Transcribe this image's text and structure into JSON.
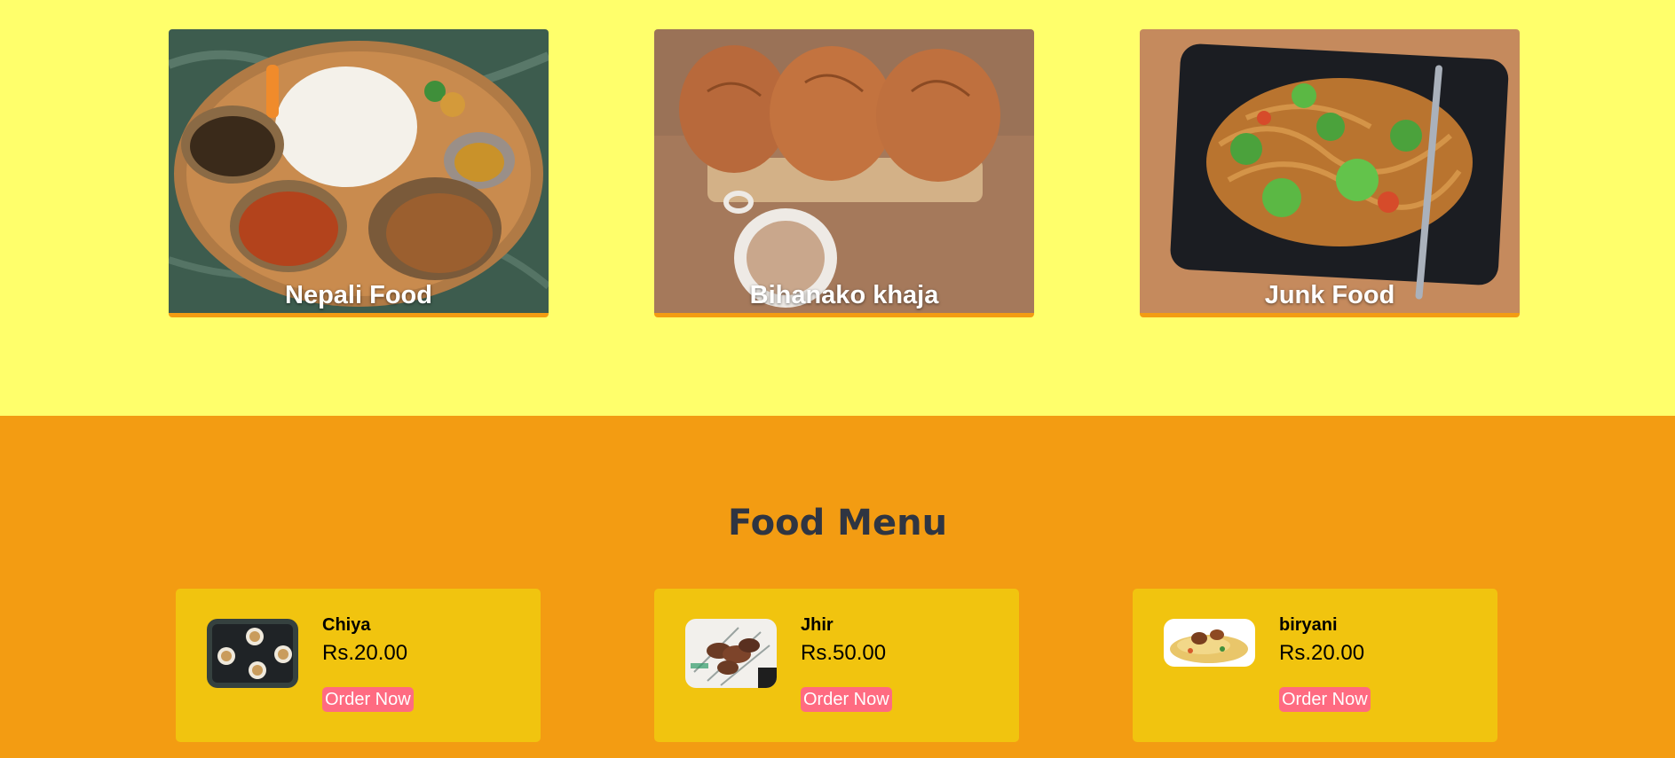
{
  "categories": [
    {
      "title": "Nepali Food",
      "image": "nepali-thali-photo"
    },
    {
      "title": "Bihanako khaja",
      "image": "bread-and-tea-photo"
    },
    {
      "title": "Junk Food",
      "image": "chowmein-photo"
    }
  ],
  "menu": {
    "heading": "Food Menu",
    "items": [
      {
        "name": "Chiya",
        "price": "Rs.20.00",
        "button": "Order Now",
        "image": "tea-cups-photo"
      },
      {
        "name": "Jhir",
        "price": "Rs.50.00",
        "button": "Order Now",
        "image": "skewers-photo"
      },
      {
        "name": "biryani",
        "price": "Rs.20.00",
        "button": "Order Now",
        "image": "biryani-photo"
      }
    ]
  },
  "colors": {
    "top_background": "#ffff6b",
    "menu_background": "#f39c12",
    "menu_card": "#f1c40f",
    "order_button": "#ff6b81",
    "heading_text": "#2f3542"
  }
}
